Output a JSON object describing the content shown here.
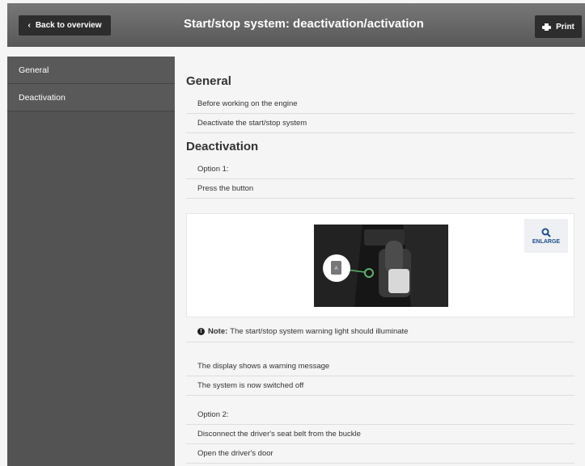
{
  "header": {
    "back_label": "Back to overview",
    "title": "Start/stop system: deactivation/activation",
    "print_label": "Print"
  },
  "sidebar": {
    "items": [
      {
        "label": "General"
      },
      {
        "label": "Deactivation"
      }
    ]
  },
  "content": {
    "general": {
      "heading": "General",
      "steps": [
        "Before working on the engine",
        "Deactivate the start/stop system"
      ]
    },
    "deactivation": {
      "heading": "Deactivation",
      "option1_label": "Option 1:",
      "option1_step": "Press the button",
      "enlarge_label": "ENLARGE",
      "note_label": "Note:",
      "note_text": "The start/stop system warning light should illuminate",
      "after_steps": [
        "The display shows a warning message",
        "The system is now switched off"
      ],
      "option2_label": "Option 2:",
      "option2_steps": [
        "Disconnect the driver's seat belt from the buckle",
        "Open the driver's door"
      ]
    }
  },
  "colors": {
    "header": "#666666",
    "sidebar": "#535353",
    "button": "#2d2d2d",
    "accent": "#1f4e8c",
    "highlight": "#5fb36b"
  }
}
